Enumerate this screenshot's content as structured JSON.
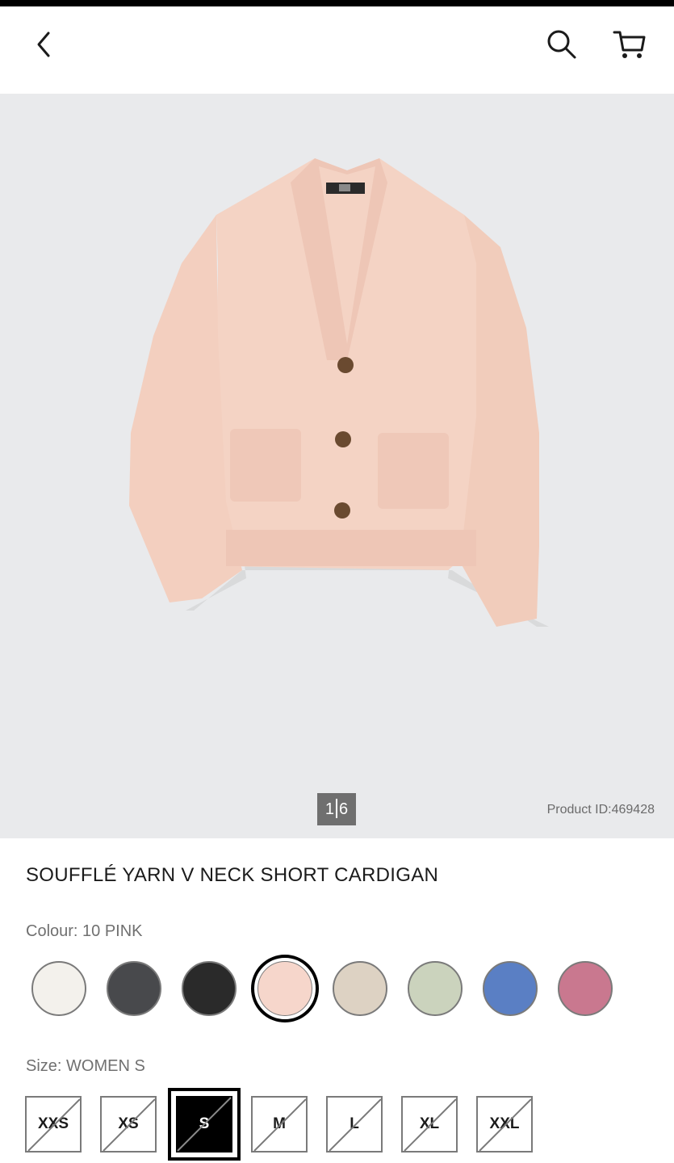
{
  "header": {
    "back_icon": "chevron-left-icon",
    "search_icon": "search-icon",
    "cart_icon": "cart-icon"
  },
  "gallery": {
    "current": "1",
    "total": "6",
    "product_id": "Product ID:469428",
    "background": "#e9eaec"
  },
  "product": {
    "title": "SOUFFLÉ YARN V NECK SHORT CARDIGAN"
  },
  "colour": {
    "label": "Colour: 10 PINK",
    "swatches": [
      {
        "name": "off-white",
        "color": "#f3f1ec"
      },
      {
        "name": "dark-gray",
        "color": "#48494c"
      },
      {
        "name": "black",
        "color": "#2a2a2a"
      },
      {
        "name": "pink",
        "color": "#f6d6cb",
        "selected": true
      },
      {
        "name": "beige",
        "color": "#ddd2c3"
      },
      {
        "name": "light-green",
        "color": "#cbd3bd"
      },
      {
        "name": "blue",
        "color": "#5a7fc4"
      },
      {
        "name": "rose",
        "color": "#c9788f"
      }
    ]
  },
  "size": {
    "label": "Size: WOMEN S",
    "options": [
      {
        "label": "XXS",
        "unavailable": true
      },
      {
        "label": "XS",
        "unavailable": true
      },
      {
        "label": "S",
        "unavailable": true,
        "selected": true
      },
      {
        "label": "M",
        "unavailable": true
      },
      {
        "label": "L",
        "unavailable": true
      },
      {
        "label": "XL",
        "unavailable": true
      },
      {
        "label": "XXL",
        "unavailable": true
      }
    ]
  }
}
